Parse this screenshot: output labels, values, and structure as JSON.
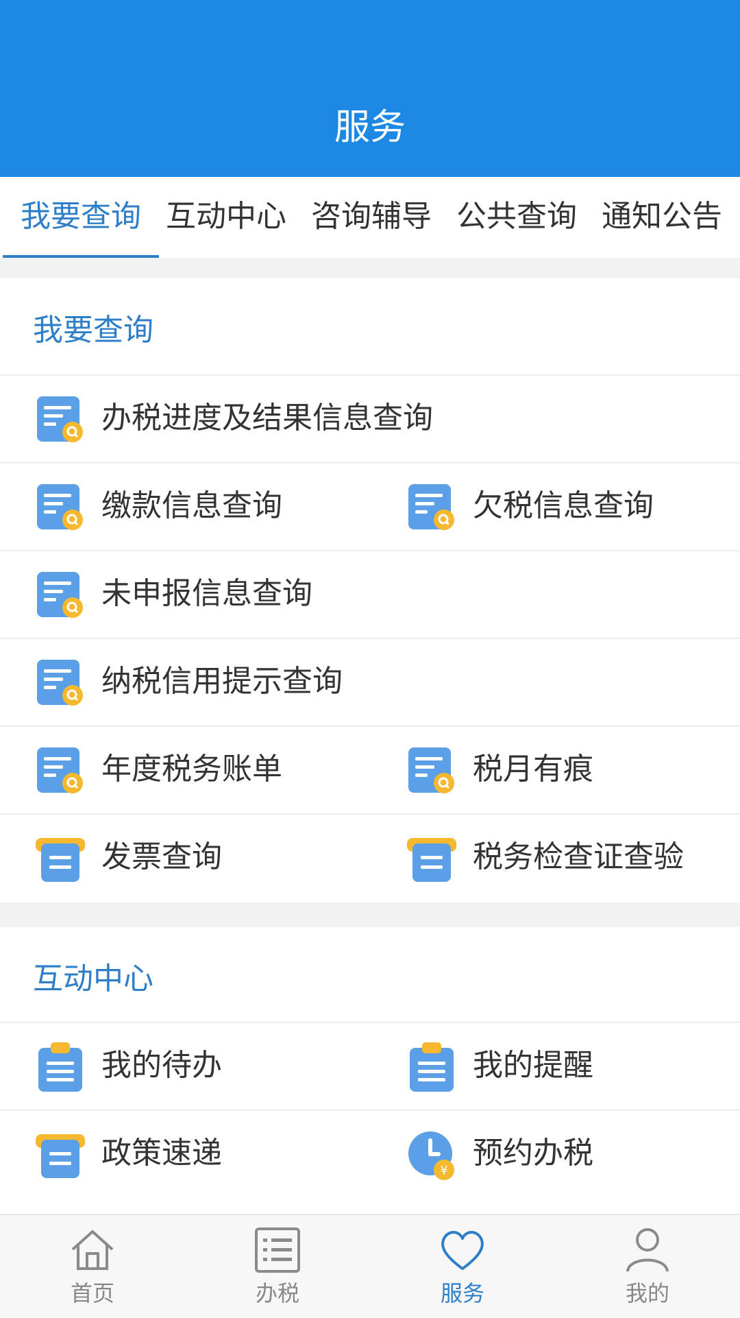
{
  "header": {
    "title": "服务"
  },
  "tabs": [
    {
      "label": "我要查询",
      "active": true
    },
    {
      "label": "互动中心",
      "active": false
    },
    {
      "label": "咨询辅导",
      "active": false
    },
    {
      "label": "公共查询",
      "active": false
    },
    {
      "label": "通知公告",
      "active": false
    }
  ],
  "sections": {
    "query": {
      "title": "我要查询",
      "items": {
        "progress": "办税进度及结果信息查询",
        "payment": "缴款信息查询",
        "arrears": "欠税信息查询",
        "undeclared": "未申报信息查询",
        "credit": "纳税信用提示查询",
        "annual_bill": "年度税务账单",
        "tax_month": "税月有痕",
        "invoice": "发票查询",
        "inspection_cert": "税务检查证查验"
      }
    },
    "interaction": {
      "title": "互动中心",
      "items": {
        "todo": "我的待办",
        "reminder": "我的提醒",
        "policy": "政策速递",
        "appointment": "预约办税"
      }
    }
  },
  "bottom_nav": [
    {
      "label": "首页",
      "icon": "home-icon",
      "active": false
    },
    {
      "label": "办税",
      "icon": "list-icon",
      "active": false
    },
    {
      "label": "服务",
      "icon": "heart-icon",
      "active": true
    },
    {
      "label": "我的",
      "icon": "user-icon",
      "active": false
    }
  ],
  "colors": {
    "header_bg": "#1c88e4",
    "accent": "#2f7fc8",
    "icon_blue": "#5b9fe6",
    "icon_yellow": "#f5b82e"
  }
}
